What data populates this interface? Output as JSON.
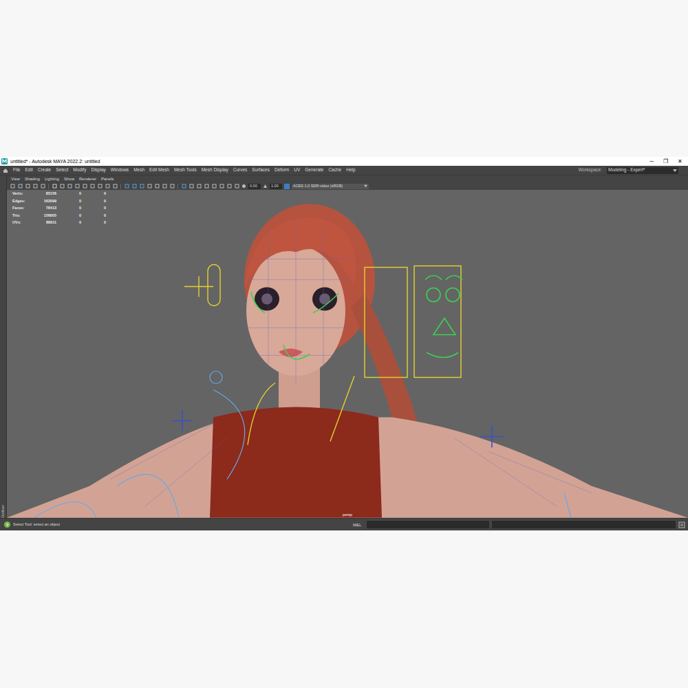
{
  "window": {
    "title": "untitled* - Autodesk MAYA 2022.2: untitled",
    "controls": [
      "─",
      "❐",
      "✕"
    ]
  },
  "menu": [
    "File",
    "Edit",
    "Create",
    "Select",
    "Modify",
    "Display",
    "Windows",
    "Mesh",
    "Edit Mesh",
    "Mesh Tools",
    "Mesh Display",
    "Curves",
    "Surfaces",
    "Deform",
    "UV",
    "Generate",
    "Cache",
    "Help"
  ],
  "workspace": {
    "label": "Workspace:",
    "value": "Modeling - Expert*"
  },
  "outliner": {
    "label": "Outliner"
  },
  "panel_menu": [
    "View",
    "Shading",
    "Lighting",
    "Show",
    "Renderer",
    "Panels"
  ],
  "toolbar": {
    "exposure": "0.00",
    "gamma": "1.00",
    "color_space": "ACES 1.0 SDR-video (sRGB)"
  },
  "hud": {
    "rows": [
      [
        "Verts:",
        "85156",
        "0",
        "0"
      ],
      [
        "Edges:",
        "163099",
        "0",
        "0"
      ],
      [
        "Faces:",
        "78413",
        "0",
        "0"
      ],
      [
        "Tris:",
        "156805",
        "0",
        "0"
      ],
      [
        "UVs:",
        "88911",
        "0",
        "0"
      ]
    ]
  },
  "camera": "persp",
  "status": {
    "icon": "?",
    "help": "Select Tool: select an object",
    "command_language": "MEL"
  }
}
